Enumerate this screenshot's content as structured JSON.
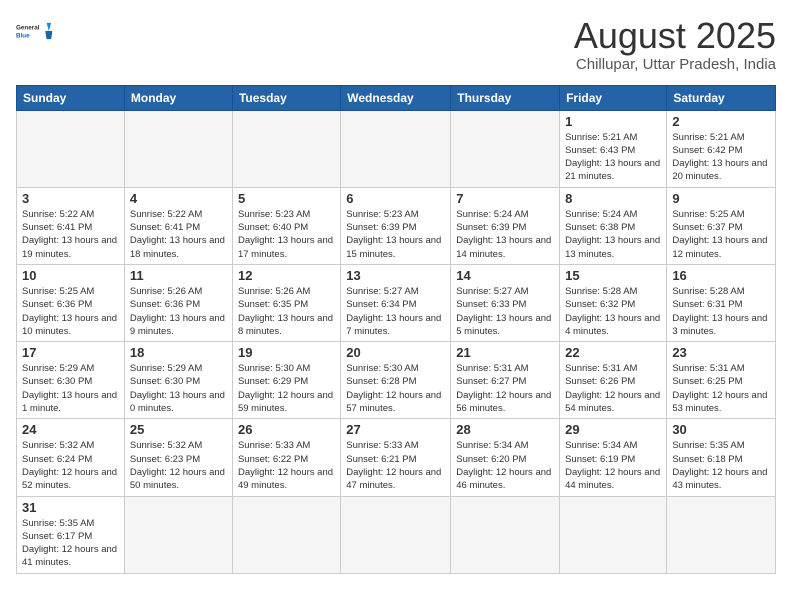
{
  "logo": {
    "text_general": "General",
    "text_blue": "Blue"
  },
  "header": {
    "month": "August 2025",
    "location": "Chillupar, Uttar Pradesh, India"
  },
  "weekdays": [
    "Sunday",
    "Monday",
    "Tuesday",
    "Wednesday",
    "Thursday",
    "Friday",
    "Saturday"
  ],
  "weeks": [
    [
      {
        "day": "",
        "info": ""
      },
      {
        "day": "",
        "info": ""
      },
      {
        "day": "",
        "info": ""
      },
      {
        "day": "",
        "info": ""
      },
      {
        "day": "",
        "info": ""
      },
      {
        "day": "1",
        "info": "Sunrise: 5:21 AM\nSunset: 6:43 PM\nDaylight: 13 hours and 21 minutes."
      },
      {
        "day": "2",
        "info": "Sunrise: 5:21 AM\nSunset: 6:42 PM\nDaylight: 13 hours and 20 minutes."
      }
    ],
    [
      {
        "day": "3",
        "info": "Sunrise: 5:22 AM\nSunset: 6:41 PM\nDaylight: 13 hours and 19 minutes."
      },
      {
        "day": "4",
        "info": "Sunrise: 5:22 AM\nSunset: 6:41 PM\nDaylight: 13 hours and 18 minutes."
      },
      {
        "day": "5",
        "info": "Sunrise: 5:23 AM\nSunset: 6:40 PM\nDaylight: 13 hours and 17 minutes."
      },
      {
        "day": "6",
        "info": "Sunrise: 5:23 AM\nSunset: 6:39 PM\nDaylight: 13 hours and 15 minutes."
      },
      {
        "day": "7",
        "info": "Sunrise: 5:24 AM\nSunset: 6:39 PM\nDaylight: 13 hours and 14 minutes."
      },
      {
        "day": "8",
        "info": "Sunrise: 5:24 AM\nSunset: 6:38 PM\nDaylight: 13 hours and 13 minutes."
      },
      {
        "day": "9",
        "info": "Sunrise: 5:25 AM\nSunset: 6:37 PM\nDaylight: 13 hours and 12 minutes."
      }
    ],
    [
      {
        "day": "10",
        "info": "Sunrise: 5:25 AM\nSunset: 6:36 PM\nDaylight: 13 hours and 10 minutes."
      },
      {
        "day": "11",
        "info": "Sunrise: 5:26 AM\nSunset: 6:36 PM\nDaylight: 13 hours and 9 minutes."
      },
      {
        "day": "12",
        "info": "Sunrise: 5:26 AM\nSunset: 6:35 PM\nDaylight: 13 hours and 8 minutes."
      },
      {
        "day": "13",
        "info": "Sunrise: 5:27 AM\nSunset: 6:34 PM\nDaylight: 13 hours and 7 minutes."
      },
      {
        "day": "14",
        "info": "Sunrise: 5:27 AM\nSunset: 6:33 PM\nDaylight: 13 hours and 5 minutes."
      },
      {
        "day": "15",
        "info": "Sunrise: 5:28 AM\nSunset: 6:32 PM\nDaylight: 13 hours and 4 minutes."
      },
      {
        "day": "16",
        "info": "Sunrise: 5:28 AM\nSunset: 6:31 PM\nDaylight: 13 hours and 3 minutes."
      }
    ],
    [
      {
        "day": "17",
        "info": "Sunrise: 5:29 AM\nSunset: 6:30 PM\nDaylight: 13 hours and 1 minute."
      },
      {
        "day": "18",
        "info": "Sunrise: 5:29 AM\nSunset: 6:30 PM\nDaylight: 13 hours and 0 minutes."
      },
      {
        "day": "19",
        "info": "Sunrise: 5:30 AM\nSunset: 6:29 PM\nDaylight: 12 hours and 59 minutes."
      },
      {
        "day": "20",
        "info": "Sunrise: 5:30 AM\nSunset: 6:28 PM\nDaylight: 12 hours and 57 minutes."
      },
      {
        "day": "21",
        "info": "Sunrise: 5:31 AM\nSunset: 6:27 PM\nDaylight: 12 hours and 56 minutes."
      },
      {
        "day": "22",
        "info": "Sunrise: 5:31 AM\nSunset: 6:26 PM\nDaylight: 12 hours and 54 minutes."
      },
      {
        "day": "23",
        "info": "Sunrise: 5:31 AM\nSunset: 6:25 PM\nDaylight: 12 hours and 53 minutes."
      }
    ],
    [
      {
        "day": "24",
        "info": "Sunrise: 5:32 AM\nSunset: 6:24 PM\nDaylight: 12 hours and 52 minutes."
      },
      {
        "day": "25",
        "info": "Sunrise: 5:32 AM\nSunset: 6:23 PM\nDaylight: 12 hours and 50 minutes."
      },
      {
        "day": "26",
        "info": "Sunrise: 5:33 AM\nSunset: 6:22 PM\nDaylight: 12 hours and 49 minutes."
      },
      {
        "day": "27",
        "info": "Sunrise: 5:33 AM\nSunset: 6:21 PM\nDaylight: 12 hours and 47 minutes."
      },
      {
        "day": "28",
        "info": "Sunrise: 5:34 AM\nSunset: 6:20 PM\nDaylight: 12 hours and 46 minutes."
      },
      {
        "day": "29",
        "info": "Sunrise: 5:34 AM\nSunset: 6:19 PM\nDaylight: 12 hours and 44 minutes."
      },
      {
        "day": "30",
        "info": "Sunrise: 5:35 AM\nSunset: 6:18 PM\nDaylight: 12 hours and 43 minutes."
      }
    ],
    [
      {
        "day": "31",
        "info": "Sunrise: 5:35 AM\nSunset: 6:17 PM\nDaylight: 12 hours and 41 minutes."
      },
      {
        "day": "",
        "info": ""
      },
      {
        "day": "",
        "info": ""
      },
      {
        "day": "",
        "info": ""
      },
      {
        "day": "",
        "info": ""
      },
      {
        "day": "",
        "info": ""
      },
      {
        "day": "",
        "info": ""
      }
    ]
  ]
}
